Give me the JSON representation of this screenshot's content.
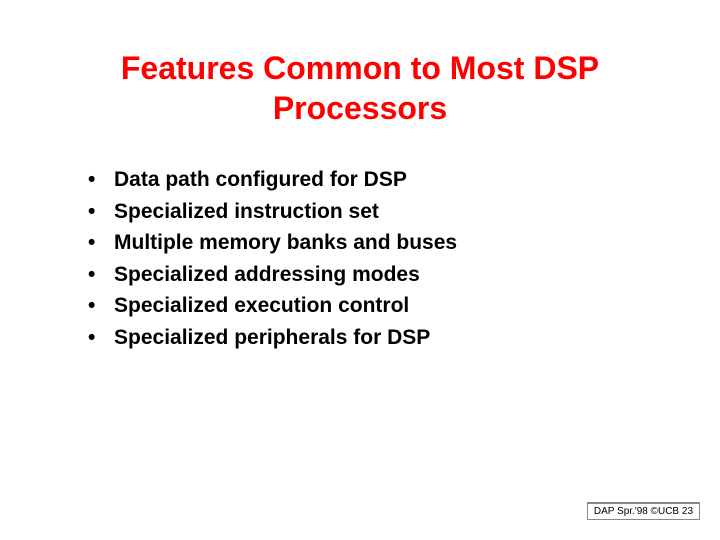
{
  "title": "Features Common to Most DSP Processors",
  "bullets": [
    "Data path configured for DSP",
    "Specialized instruction set",
    "Multiple memory banks and buses",
    "Specialized addressing modes",
    "Specialized execution control",
    "Specialized peripherals for DSP"
  ],
  "footer": "DAP Spr.'98 ©UCB 23"
}
